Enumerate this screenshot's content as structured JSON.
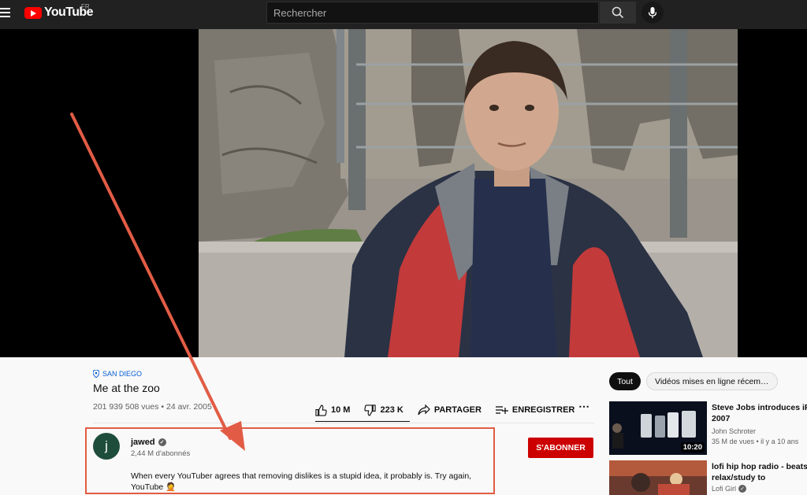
{
  "header": {
    "logo_text": "YouTube",
    "country_code": "FR",
    "search_placeholder": "Rechercher"
  },
  "video": {
    "location": "SAN DIEGO",
    "title": "Me at the zoo",
    "views_date": "201 939 508 vues • 24 avr. 2005",
    "actions": {
      "like": "10 M",
      "dislike": "223 K",
      "share": "PARTAGER",
      "save": "ENREGISTRER",
      "more": "⋯"
    }
  },
  "channel": {
    "avatar_letter": "j",
    "name": "jawed",
    "subscribers": "2,44 M d'abonnés",
    "subscribe_label": "S'ABONNER",
    "description_line1": "When every YouTuber agrees that removing dislikes is a stupid idea, it probably is. Try again,",
    "description_line2": "YouTube 🤦"
  },
  "sidebar": {
    "chips": [
      "Tout",
      "Vidéos mises en ligne récem…"
    ],
    "recommendations": [
      {
        "title_line1": "Steve Jobs introduces iPh",
        "title_line2": "2007",
        "channel": "John Schroter",
        "meta": "35 M de vues • il y a 10 ans",
        "duration": "10:20"
      },
      {
        "title_line1": "lofi hip hop radio - beats to",
        "title_line2": "relax/study to",
        "channel": "Lofi Girl"
      }
    ]
  },
  "colors": {
    "brand_red": "#ff0000",
    "subscribe_red": "#cc0000",
    "annotation_red": "#e25c45",
    "link_blue": "#065fd4",
    "avatar_green": "#1e4d3b"
  }
}
